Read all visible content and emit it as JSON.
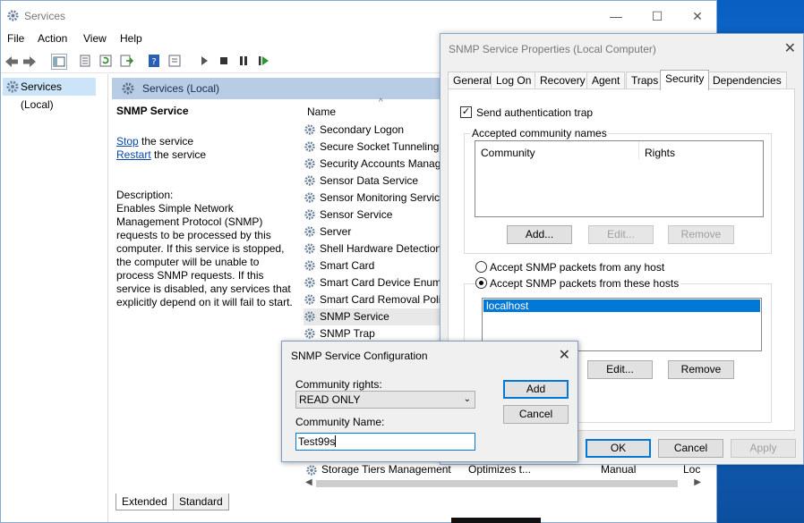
{
  "window": {
    "title": "Services",
    "controls": {
      "minimize": "—",
      "maximize": "☐",
      "close": "✕"
    }
  },
  "menu": [
    "File",
    "Action",
    "View",
    "Help"
  ],
  "tree": {
    "root": "Services (Local)"
  },
  "pane": {
    "header": "Services (Local)",
    "service_name": "SNMP Service",
    "stop_link": "Stop",
    "stop_suffix": " the service",
    "restart_link": "Restart",
    "restart_suffix": " the service",
    "description_label": "Description:",
    "description_text": "Enables Simple Network Management Protocol (SNMP) requests to be processed by this computer. If this service is stopped, the computer will be unable to process SNMP requests. If this service is disabled, any services that explicitly depend on it will fail to start."
  },
  "list": {
    "column_name": "Name",
    "sort_indicator": "^",
    "rows": [
      "Secondary Logon",
      "Secure Socket Tunneling",
      "Security Accounts Manag",
      "Sensor Data Service",
      "Sensor Monitoring Service",
      "Sensor Service",
      "Server",
      "Shell Hardware Detection",
      "Smart Card",
      "Smart Card Device Enume",
      "Smart Card Removal Polic",
      "SNMP Service",
      "SNMP Trap"
    ],
    "selected_row": "SNMP Service",
    "bottom_row": {
      "name": "Storage Tiers Management",
      "description": "Optimizes t...",
      "startup": "Manual",
      "logon": "Loc"
    }
  },
  "bottom_tabs": [
    "Extended",
    "Standard"
  ],
  "properties": {
    "title": "SNMP Service Properties (Local Computer)",
    "close": "✕",
    "tabs": [
      "General",
      "Log On",
      "Recovery",
      "Agent",
      "Traps",
      "Security",
      "Dependencies"
    ],
    "active_tab": "Security",
    "send_auth_trap": "Send authentication trap",
    "send_auth_trap_checked": true,
    "accepted_group": "Accepted community names",
    "col_community": "Community",
    "col_rights": "Rights",
    "add_btn": "Add...",
    "edit_btn": "Edit...",
    "remove_btn": "Remove",
    "radio_any": "Accept SNMP packets from any host",
    "radio_these": "Accept SNMP packets from these hosts",
    "hosts": [
      "localhost"
    ],
    "hosts_edit_btn": "Edit...",
    "hosts_remove_btn": "Remove",
    "ok": "OK",
    "cancel": "Cancel",
    "apply": "Apply"
  },
  "config": {
    "title": "SNMP Service Configuration",
    "close": "✕",
    "rights_label": "Community rights:",
    "rights_value": "READ ONLY",
    "name_label": "Community Name:",
    "name_value": "Test99s",
    "add": "Add",
    "cancel": "Cancel"
  }
}
